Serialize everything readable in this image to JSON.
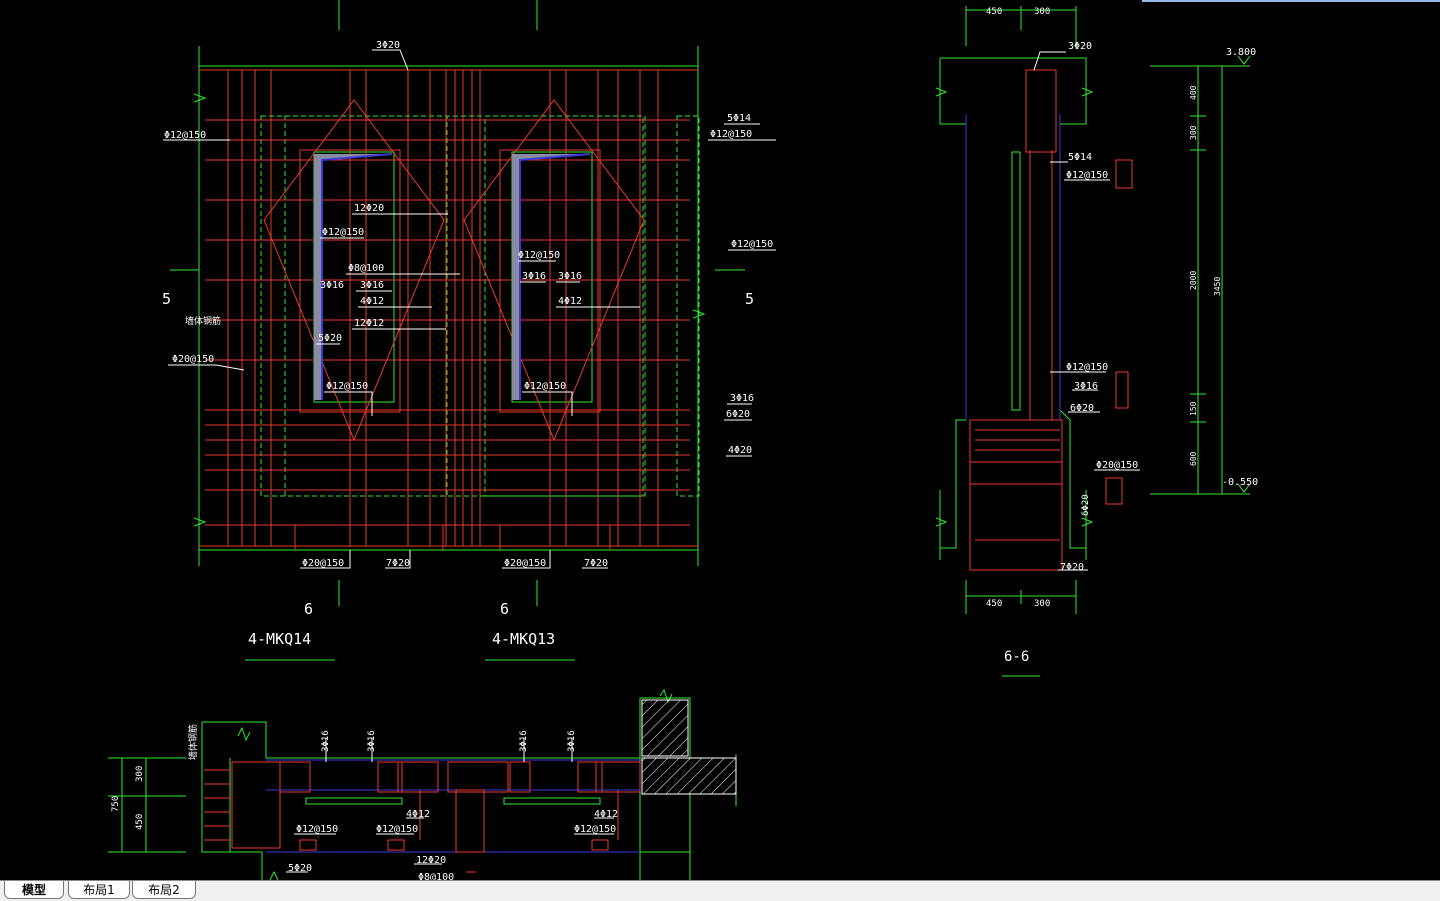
{
  "colors": {
    "background": "#000000",
    "rebar": "#e83a2c",
    "outline": "#2eea2e",
    "hidden": "#3a3ad8",
    "text": "#ffffff",
    "shade": "#8a8aa0"
  },
  "elevation": {
    "section_marks": {
      "left": "5",
      "right": "5",
      "bottom_left": "6",
      "bottom_right": "6"
    },
    "captions": {
      "left": "4-MKQ14",
      "right": "4-MKQ13"
    },
    "labels": {
      "top_bar": "3Φ20",
      "left_dist": "Φ12@150",
      "right_5phi14": "5Φ14",
      "right_dist": "Φ12@150",
      "right_mid": "Φ12@150",
      "right_3phi16": "3Φ16",
      "right_6phi20": "6Φ20",
      "right_4phi20": "4Φ20",
      "left_20_150": "Φ20@150",
      "left_side_note": "墙体钢筋",
      "left_12phi20": "12Φ20",
      "left_phi12_150": "Φ12@150",
      "left_phi8_100": "Φ8@100",
      "left_3phi16_a": "3Φ16",
      "left_3phi16_b": "3Φ16",
      "left_4phi12": "4Φ12",
      "left_12phi12": "12Φ12",
      "left_5phi20": "5Φ20",
      "left_bot_phi12": "Φ12@150",
      "right_inner_phi12": "Φ12@150",
      "right_inner_3phi16_a": "3Φ16",
      "right_inner_3phi16_b": "3Φ16",
      "right_inner_4phi12": "4Φ12",
      "right_bot_phi12": "Φ12@150",
      "bottom_l_phi20": "Φ20@150",
      "bottom_l_7phi20": "7Φ20",
      "bottom_r_phi20": "Φ20@150",
      "bottom_r_7phi20": "7Φ20"
    }
  },
  "section66": {
    "title": "6-6",
    "dims_top": [
      "450",
      "300"
    ],
    "dims_bottom": [
      "450",
      "300"
    ],
    "levels": {
      "top": "3.800",
      "bottom": "-0.550"
    },
    "vertical_dims": [
      "400",
      "300",
      "2000",
      "150",
      "600"
    ],
    "total_dim": "3450",
    "labels": {
      "top_3phi20": "3Φ20",
      "l_5phi14": "5Φ14",
      "l_phi12_150": "Φ12@150",
      "l_phi12_150_b": "Φ12@150",
      "l_3phi16": "3Φ16",
      "l_6phi20": "6Φ20",
      "l_phi20_150": "Φ20@150",
      "l_6phi20_v": "6Φ20",
      "l_7phi20": "7Φ20"
    }
  },
  "plan": {
    "dims": {
      "total": "750",
      "upper": "300",
      "lower": "450"
    },
    "labels": {
      "side_note": "墙体钢筋",
      "v1": "3Φ16",
      "v2": "3Φ16",
      "v3": "3Φ16",
      "v4": "3Φ16",
      "a_4phi12": "4Φ12",
      "b_4phi12": "4Φ12",
      "a_phi12": "Φ12@150",
      "b_phi12": "Φ12@150",
      "c_phi12": "Φ12@150",
      "d_12phi20": "12Φ20",
      "e_5phi20": "5Φ20",
      "f_phi8": "Φ8@100"
    }
  },
  "tabs": [
    {
      "label": "模型",
      "active": true
    },
    {
      "label": "布局1",
      "active": false
    },
    {
      "label": "布局2",
      "active": false
    }
  ]
}
